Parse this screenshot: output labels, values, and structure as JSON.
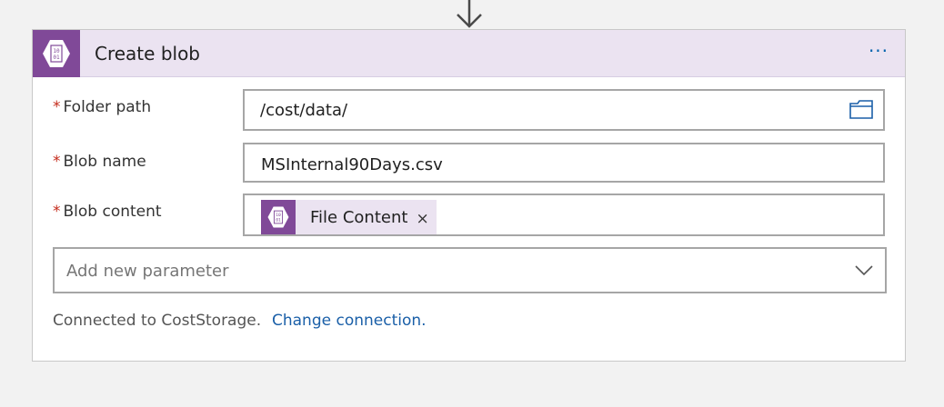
{
  "card": {
    "title": "Create blob",
    "more_label": "···",
    "accent_color": "#804998",
    "header_bg": "#ebe3f1",
    "icon": "blob-storage-icon"
  },
  "fields": [
    {
      "required_marker": "*",
      "label": "Folder path",
      "value": "/cost/data/",
      "action_icon": "folder-icon"
    },
    {
      "required_marker": "*",
      "label": "Blob name",
      "value": "MSInternal90Days.csv"
    },
    {
      "required_marker": "*",
      "label": "Blob content",
      "token": {
        "label": "File Content",
        "remove_label": "×",
        "icon": "blob-storage-icon"
      }
    }
  ],
  "add_parameter": {
    "placeholder": "Add new parameter",
    "icon": "chevron-down-icon"
  },
  "connection": {
    "text": "Connected to CostStorage.",
    "change_link": "Change connection.",
    "link_color": "#1a5fa8"
  }
}
